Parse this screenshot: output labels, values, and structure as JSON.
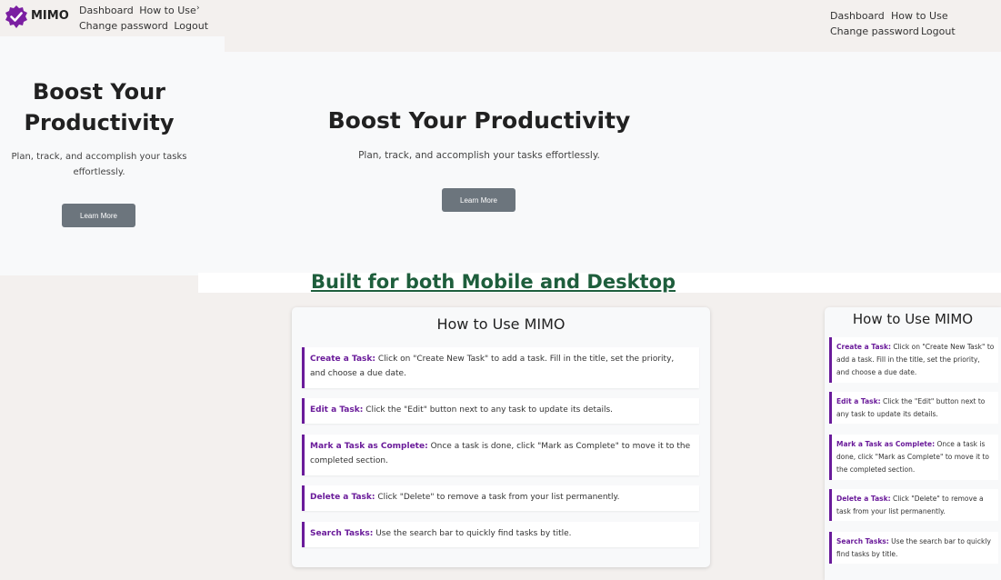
{
  "brand": {
    "name": "MIMO",
    "accent": "#6a1b9a"
  },
  "nav": {
    "dashboard": "Dashboard",
    "how_to_use": "How to Use",
    "change_password": "Change password",
    "logout": "Logout"
  },
  "hero": {
    "title": "Boost Your Productivity",
    "subtitle": "Plan, track, and accomplish your tasks effortlessly.",
    "button": "Learn More"
  },
  "mobile_hero": {
    "title_line1": "Boost Your",
    "title_line2": "Productivity",
    "subtitle_line1": "Plan, track, and accomplish your tasks",
    "subtitle_line2": "effortlessly."
  },
  "banner": "Built for both Mobile and Desktop",
  "how_to": {
    "title": "How to Use MIMO",
    "steps": [
      {
        "title": "Create a Task:",
        "text": "Click on \"Create New Task\" to add a task. Fill in the title, set the priority, and choose a due date."
      },
      {
        "title": "Edit a Task:",
        "text": "Click the \"Edit\" button next to any task to update its details."
      },
      {
        "title": "Mark a Task as Complete:",
        "text": "Once a task is done, click \"Mark as Complete\" to move it to the completed section."
      },
      {
        "title": "Delete a Task:",
        "text": "Click \"Delete\" to remove a task from your list permanently."
      },
      {
        "title": "Search Tasks:",
        "text": "Use the search bar to quickly find tasks by title."
      }
    ]
  },
  "colors": {
    "button": "#6c757d",
    "banner": "#1e5e3c",
    "hero_bg": "#f8f9fa",
    "page_bg": "#f3f0ee"
  }
}
